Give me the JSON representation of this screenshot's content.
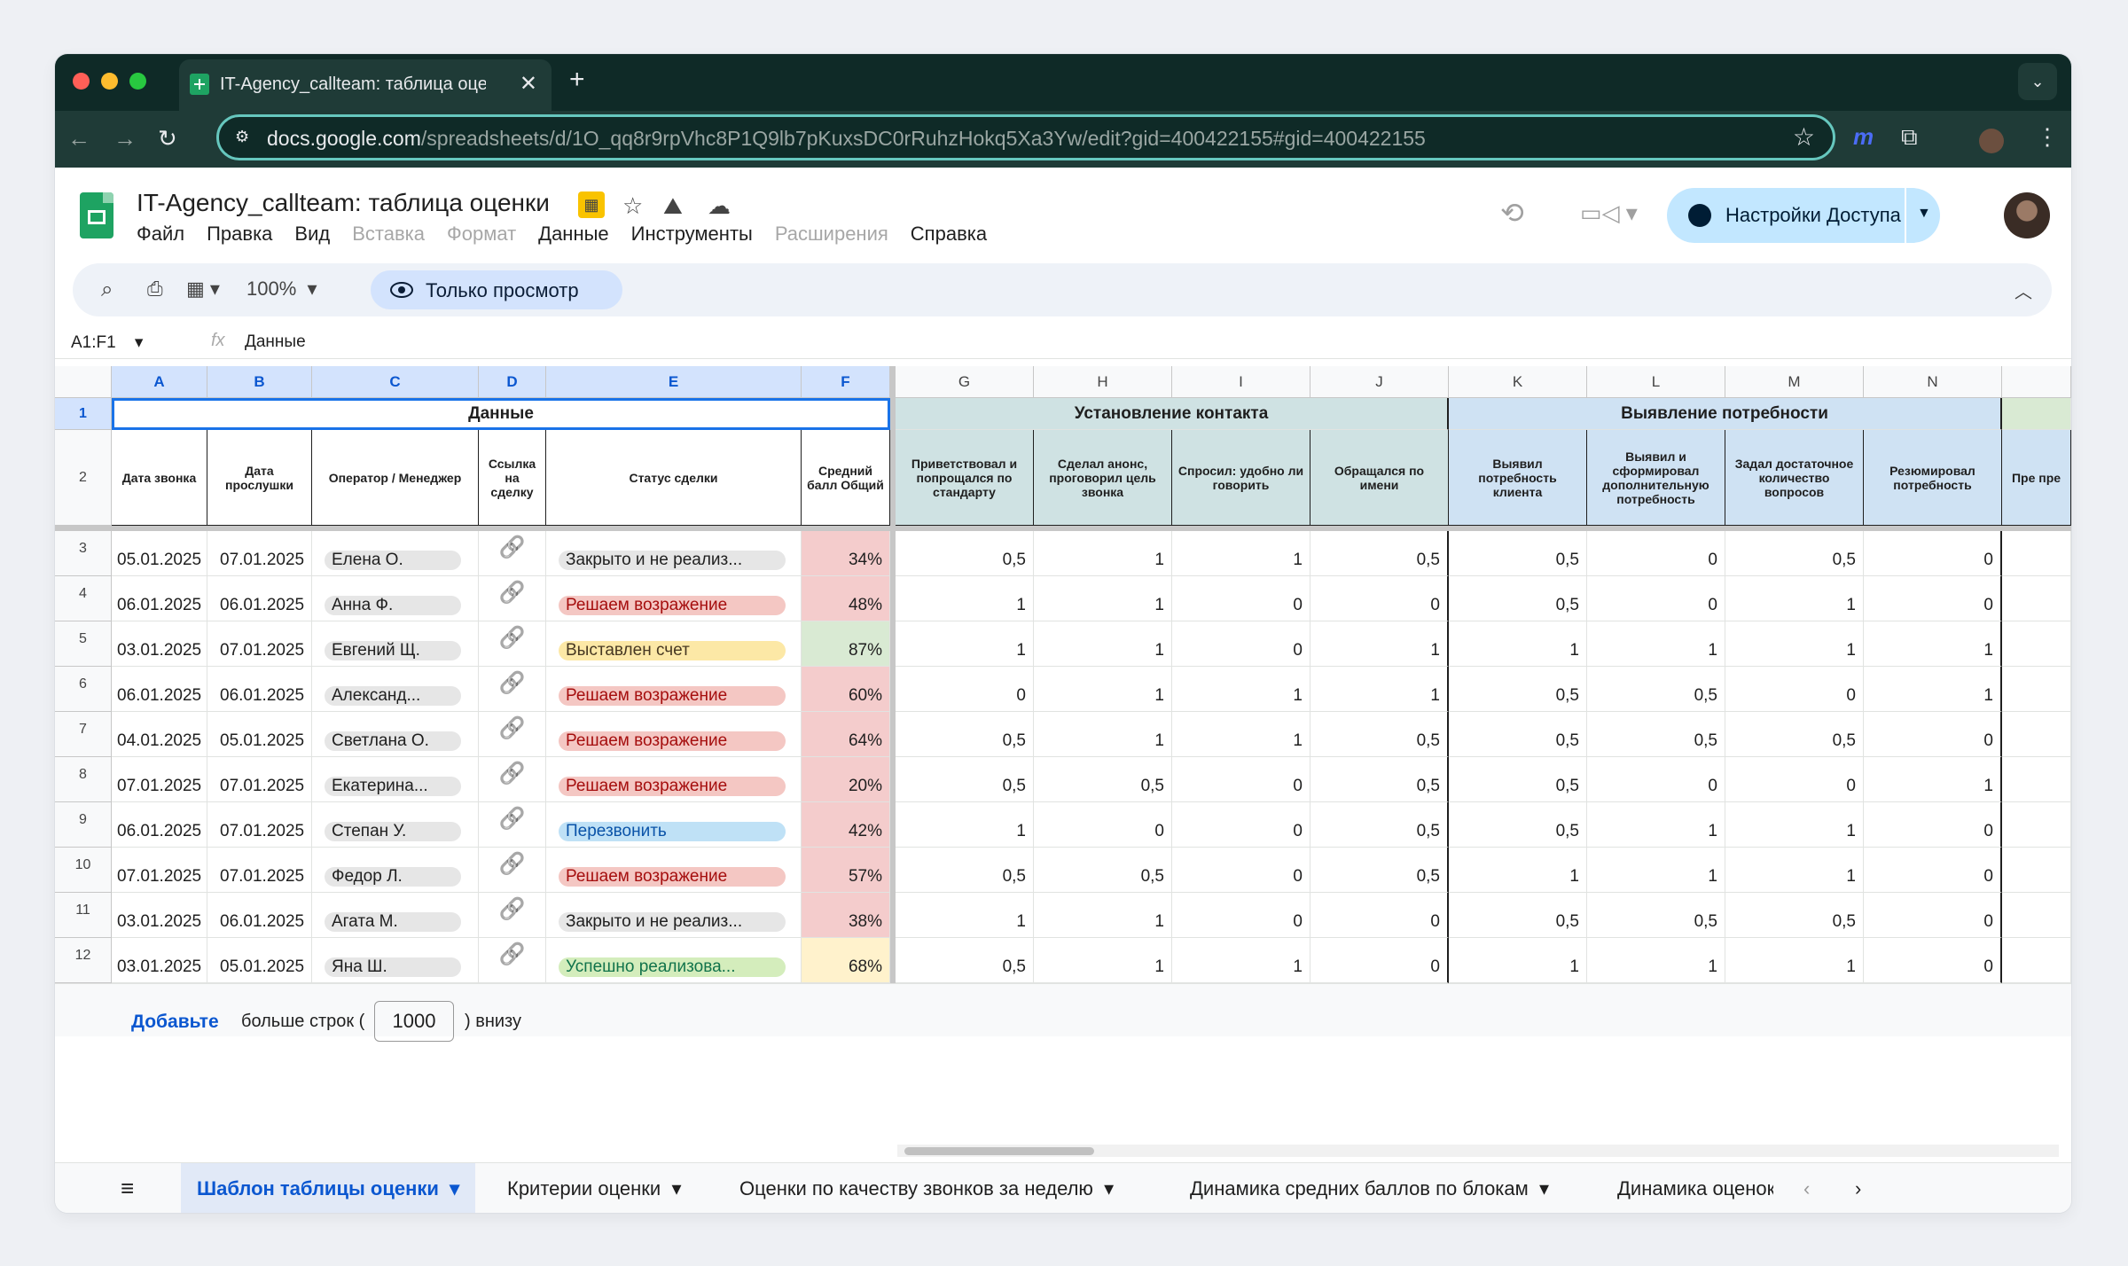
{
  "browser": {
    "tab_title": "IT-Agency_callteam: таблица оценки",
    "url_host": "docs.google.com",
    "url_path": "/spreadsheets/d/1O_qq8r9rpVhc8P1Q9lb7pKuxsDC0rRuhzHokq5Xa3Yw/edit?gid=400422155#gid=400422155"
  },
  "doc": {
    "title": "IT-Agency_callteam: таблица оценки",
    "menu": [
      {
        "label": "Файл",
        "enabled": true
      },
      {
        "label": "Правка",
        "enabled": true
      },
      {
        "label": "Вид",
        "enabled": true
      },
      {
        "label": "Вставка",
        "enabled": false
      },
      {
        "label": "Формат",
        "enabled": false
      },
      {
        "label": "Данные",
        "enabled": true
      },
      {
        "label": "Инструменты",
        "enabled": true
      },
      {
        "label": "Расширения",
        "enabled": false
      },
      {
        "label": "Справка",
        "enabled": true
      }
    ],
    "share_label": "Настройки Доступа"
  },
  "toolbar": {
    "zoom": "100%",
    "view_only": "Только просмотр"
  },
  "formula": {
    "name_box": "A1:F1",
    "value": "Данные"
  },
  "columns": [
    "A",
    "B",
    "C",
    "D",
    "E",
    "F",
    "G",
    "H",
    "I",
    "J",
    "K",
    "L",
    "M",
    "N"
  ],
  "groups": {
    "data": "Данные",
    "contact": "Установление контакта",
    "needs": "Выявление потребности"
  },
  "headers": {
    "A": "Дата звонка",
    "B": "Дата прослушки",
    "C": "Оператор / Менеджер",
    "D": "Ссылка на сделку",
    "E": "Статус сделки",
    "F": "Средний балл Общий",
    "G": "Приветствовал и попрощался по стандарту",
    "H": "Сделал анонс, проговорил цель звонка",
    "I": "Спросил: удобно ли говорить",
    "J": "Обращался по имени",
    "K": "Выявил потребность клиента",
    "L": "Выявил и сформировал дополнительную потребность",
    "M": "Задал достаточное количество вопросов",
    "N": "Резюмировал потребность",
    "O": "Пре пре"
  },
  "rows": [
    {
      "n": "3",
      "a": "05.01.2025",
      "b": "07.01.2025",
      "c": "Елена О.",
      "e": "Закрыто и не реализ...",
      "status": "closed",
      "f": "34%",
      "g": "0,5",
      "h": "1",
      "i": "1",
      "j": "0,5",
      "k": "0,5",
      "l": "0",
      "m": "0,5",
      "nn": "0"
    },
    {
      "n": "4",
      "a": "06.01.2025",
      "b": "06.01.2025",
      "c": "Анна Ф.",
      "e": "Решаем возражение",
      "status": "objection",
      "f": "48%",
      "g": "1",
      "h": "1",
      "i": "0",
      "j": "0",
      "k": "0,5",
      "l": "0",
      "m": "1",
      "nn": "0"
    },
    {
      "n": "5",
      "a": "03.01.2025",
      "b": "07.01.2025",
      "c": "Евгений Щ.",
      "e": "Выставлен счет",
      "status": "invoice",
      "f": "87%",
      "g": "1",
      "h": "1",
      "i": "0",
      "j": "1",
      "k": "1",
      "l": "1",
      "m": "1",
      "nn": "1"
    },
    {
      "n": "6",
      "a": "06.01.2025",
      "b": "06.01.2025",
      "c": "Александ...",
      "e": "Решаем возражение",
      "status": "objection",
      "f": "60%",
      "g": "0",
      "h": "1",
      "i": "1",
      "j": "1",
      "k": "0,5",
      "l": "0,5",
      "m": "0",
      "nn": "1"
    },
    {
      "n": "7",
      "a": "04.01.2025",
      "b": "05.01.2025",
      "c": "Светлана О.",
      "e": "Решаем возражение",
      "status": "objection",
      "f": "64%",
      "g": "0,5",
      "h": "1",
      "i": "1",
      "j": "0,5",
      "k": "0,5",
      "l": "0,5",
      "m": "0,5",
      "nn": "0"
    },
    {
      "n": "8",
      "a": "07.01.2025",
      "b": "07.01.2025",
      "c": "Екатерина...",
      "e": "Решаем возражение",
      "status": "objection",
      "f": "20%",
      "g": "0,5",
      "h": "0,5",
      "i": "0",
      "j": "0,5",
      "k": "0,5",
      "l": "0",
      "m": "0",
      "nn": "1"
    },
    {
      "n": "9",
      "a": "06.01.2025",
      "b": "07.01.2025",
      "c": "Степан У.",
      "e": "Перезвонить",
      "status": "callback",
      "f": "42%",
      "g": "1",
      "h": "0",
      "i": "0",
      "j": "0,5",
      "k": "0,5",
      "l": "1",
      "m": "1",
      "nn": "0"
    },
    {
      "n": "10",
      "a": "07.01.2025",
      "b": "07.01.2025",
      "c": "Федор Л.",
      "e": "Решаем возражение",
      "status": "objection",
      "f": "57%",
      "g": "0,5",
      "h": "0,5",
      "i": "0",
      "j": "0,5",
      "k": "1",
      "l": "1",
      "m": "1",
      "nn": "0"
    },
    {
      "n": "11",
      "a": "03.01.2025",
      "b": "06.01.2025",
      "c": "Агата М.",
      "e": "Закрыто и не реализ...",
      "status": "closed",
      "f": "38%",
      "g": "1",
      "h": "1",
      "i": "0",
      "j": "0",
      "k": "0,5",
      "l": "0,5",
      "m": "0,5",
      "nn": "0"
    },
    {
      "n": "12",
      "a": "03.01.2025",
      "b": "05.01.2025",
      "c": "Яна Ш.",
      "e": "Успешно реализова...",
      "status": "success",
      "f": "68%",
      "g": "0,5",
      "h": "1",
      "i": "1",
      "j": "0",
      "k": "1",
      "l": "1",
      "m": "1",
      "nn": "0"
    }
  ],
  "add_rows": {
    "link": "Добавьте",
    "text1": "больше строк (",
    "count": "1000",
    "text2": ") внизу"
  },
  "sheets": [
    "Шаблон таблицы оценки",
    "Критерии оценки",
    "Оценки по качеству звонков за неделю",
    "Динамика средних баллов по блокам",
    "Динамика оценок"
  ],
  "colors": {
    "objection": "#f4c7c3",
    "invoice": "#fce8a6",
    "callback": "#bfe1f6",
    "success": "#d4edbc",
    "closed": "#e6e6e6",
    "low": "#f4cccc",
    "high": "#d9ead3",
    "mid": "#fff2cc"
  }
}
